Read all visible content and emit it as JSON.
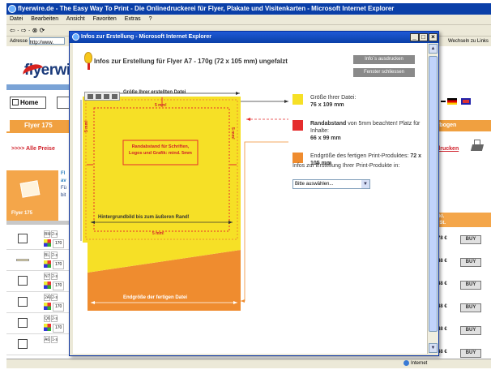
{
  "background_browser": {
    "title": "flyerwire.de - The Easy Way To Print - Die Onlinedruckerei für Flyer, Plakate und Visitenkarten - Microsoft Internet Explorer",
    "menu": [
      "Datei",
      "Bearbeiten",
      "Ansicht",
      "Favoriten",
      "Extras",
      "?"
    ],
    "address_label": "Adresse",
    "address_value": "http://www.",
    "links": "Wechseln zu  Links",
    "status_zone": "Internet",
    "logo_text": "flyerwi",
    "home_label": "Home",
    "left_tab": "Flyer 175",
    "alle_preise": ">>>> Alle Preise",
    "left_box_label": "Flyer 175",
    "left_info_lines": [
      "Fl",
      "av",
      "Fü",
      "bit"
    ],
    "right_tab": "fbogen",
    "right_link": "drucken",
    "right_head_lines": [
      "ikl.",
      "rSt."
    ],
    "rows": [
      {
        "code": "BM",
        "num": "2-s",
        "qty": "170"
      },
      {
        "code": "BL",
        "num": "2-s",
        "qty": "170"
      },
      {
        "code": "N7",
        "num": "2-s",
        "qty": "170"
      },
      {
        "code": "2A7",
        "num": "2-s",
        "qty": "170"
      },
      {
        "code": "Q6",
        "num": "2-s",
        "qty": "170"
      },
      {
        "code": "A6",
        "num": "1-s",
        "qty": "170"
      }
    ],
    "prices": [
      "78 €",
      "48 €",
      "48 €",
      "48 €",
      "48 €",
      "48 €"
    ],
    "buy_label": "BUY"
  },
  "popup": {
    "title": "Infos zur Erstellung - Microsoft Internet Explorer",
    "heading": "Infos zur Erstellung für Flyer A7 - 170g (72 x 105 mm) ungefalzt",
    "print_button": "Info´s ausdrucken",
    "close_button": "Fenster schliessen",
    "diagram": {
      "top_label": "Größe Ihrer erstellten Datei",
      "margin_top": "5 mm!",
      "margin_left": "5 mm!",
      "margin_right": "5 mm!",
      "margin_bottom": "5 mm!",
      "center_label": "Randabstand für Schriften, Logos und Grafik: mind. 5mm",
      "hint": "Hintergrundbild bis zum äußeren Rand!",
      "bottom_label": "Endgröße der fertigen Datei"
    },
    "legend": [
      {
        "color": "#f6e026",
        "text_pre": "Größe Ihrer Datei:",
        "text_bold": "76 x 109 mm"
      },
      {
        "color": "#e52d2d",
        "text_bold": "Randabstand",
        "text_mid": " von 5mm beachten! Platz für Inhalte:",
        "text_bold2": "66 x 99 mm"
      },
      {
        "color": "#ef8c2f",
        "text_pre": "Endgröße des fertigen Print-Produktes:",
        "text_bold": "72 x 105 mm"
      }
    ],
    "product_label": "Infos zur Erstellung Ihrer Print-Produkte in:",
    "select_value": "Bitte auswählen..."
  },
  "colors": {
    "yellow": "#f6e026",
    "red": "#e52d2d",
    "orange": "#ef8c2f",
    "title_blue": "#0a3fa8"
  }
}
